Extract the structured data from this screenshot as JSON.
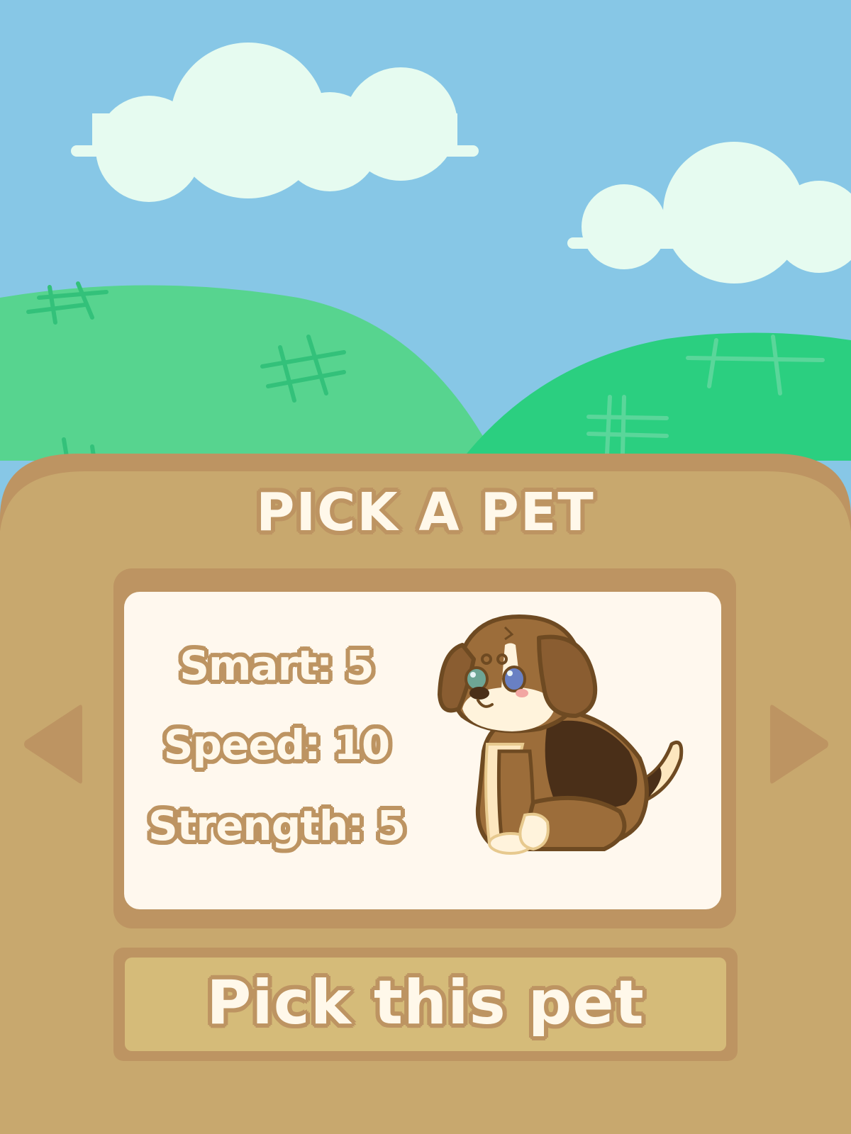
{
  "screen": {
    "title": "PICK A PET"
  },
  "pet": {
    "species": "dog",
    "icon": "beagle-puppy-icon",
    "stats": [
      {
        "label": "Smart:",
        "value": "5"
      },
      {
        "label": "Speed:",
        "value": "10"
      },
      {
        "label": "Strength:",
        "value": "5"
      }
    ]
  },
  "actions": {
    "pick_label": "Pick this pet",
    "prev_icon": "triangle-left-icon",
    "next_icon": "triangle-right-icon"
  },
  "colors": {
    "sky": "#87c7e6",
    "cloud": "#e6fbf0",
    "hill_left": "#57d48f",
    "hill_right": "#2bcf80",
    "panel": "#c8a86e",
    "panel_border": "#bd9462",
    "card": "#fff8ee",
    "button": "#d5bb79",
    "text": "#fff8ea"
  }
}
